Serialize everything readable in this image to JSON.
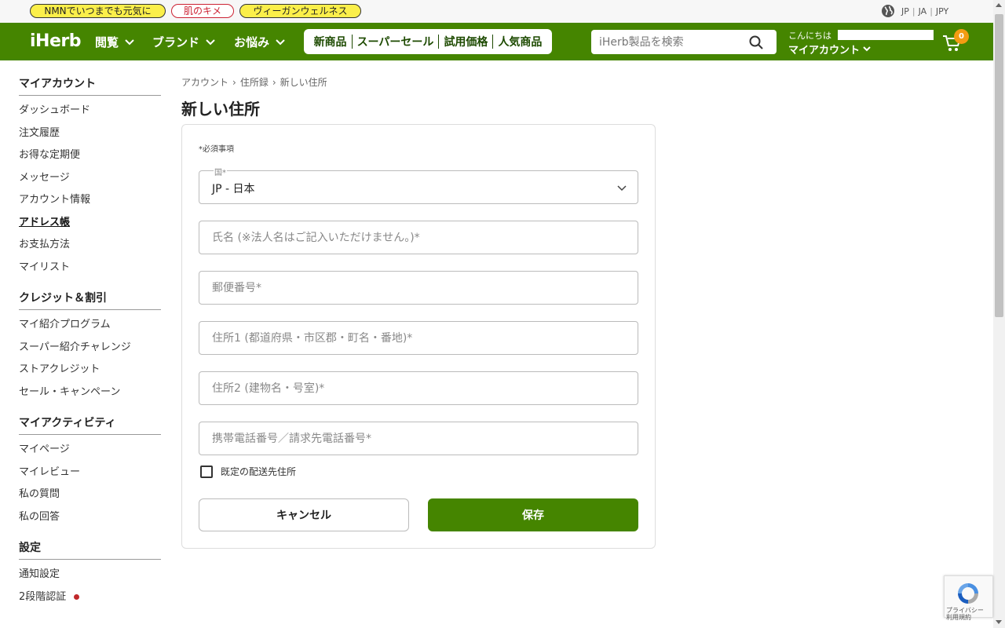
{
  "promo": {
    "pill1": "NMNでいつまでも元気に",
    "pill2": "肌のキメ",
    "pill3": "ヴィーガンウェルネス"
  },
  "locale": {
    "country": "JP",
    "language": "JA",
    "currency": "JPY"
  },
  "header": {
    "logo": "iHerb",
    "menu": [
      "閲覧",
      "ブランド",
      "お悩み"
    ],
    "quick_links": [
      "新商品",
      "スーパーセール",
      "試用価格",
      "人気商品"
    ],
    "search_placeholder": "iHerb製品を検索",
    "greeting": "こんにちは",
    "my_account": "マイアカウント",
    "cart_count": "0"
  },
  "sidebar": {
    "sections": [
      {
        "title": "マイアカウント",
        "items": [
          "ダッシュボード",
          "注文履歴",
          "お得な定期便",
          "メッセージ",
          "アカウント情報",
          "アドレス帳",
          "お支払方法",
          "マイリスト"
        ]
      },
      {
        "title": "クレジット＆割引",
        "items": [
          "マイ紹介プログラム",
          "スーパー紹介チャレンジ",
          "ストアクレジット",
          "セール・キャンペーン"
        ]
      },
      {
        "title": "マイアクティビティ",
        "items": [
          "マイページ",
          "マイレビュー",
          "私の質問",
          "私の回答"
        ]
      },
      {
        "title": "設定",
        "items": [
          "通知設定",
          "2段階認証"
        ]
      }
    ]
  },
  "breadcrumb": [
    "アカウント",
    "住所録",
    "新しい住所"
  ],
  "page_title": "新しい住所",
  "form": {
    "required_note": "*必須事項",
    "country_label": "国*",
    "country_value": "JP - 日本",
    "name_placeholder": "氏名 (※法人名はご記入いただけません。)*",
    "postal_placeholder": "郵便番号*",
    "address1_placeholder": "住所1 (都道府県・市区郡・町名・番地)*",
    "address2_placeholder": "住所2 (建物名・号室)*",
    "phone_placeholder": "携帯電話番号／請求先電話番号*",
    "default_checkbox_label": "既定の配送先住所",
    "cancel_label": "キャンセル",
    "save_label": "保存"
  },
  "recaptcha": {
    "text1": "プライバシー",
    "text2": "利用規約"
  },
  "colors": {
    "brand_green": "#458500",
    "badge_orange": "#f39c12",
    "promo_yellow": "#fbef4a"
  }
}
